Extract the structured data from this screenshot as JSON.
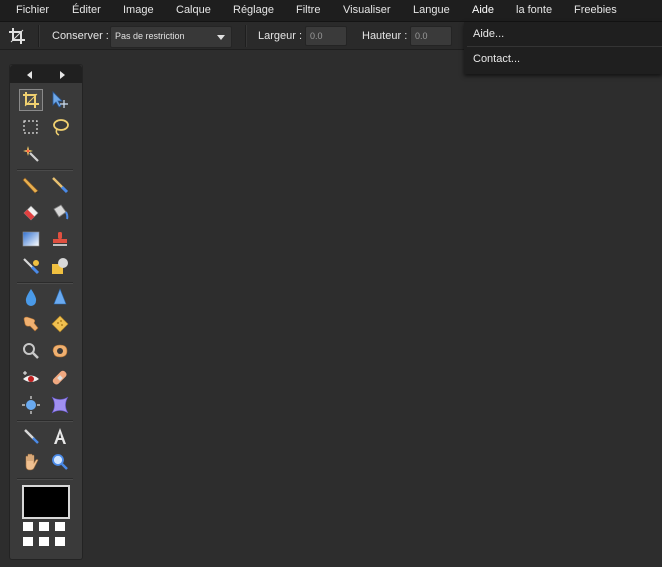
{
  "menubar": {
    "items": [
      {
        "label": "Fichier"
      },
      {
        "label": "Éditer"
      },
      {
        "label": "Image"
      },
      {
        "label": "Calque"
      },
      {
        "label": "Réglage"
      },
      {
        "label": "Filtre"
      },
      {
        "label": "Visualiser"
      },
      {
        "label": "Langue"
      },
      {
        "label": "Aide"
      },
      {
        "label": "la fonte"
      },
      {
        "label": "Freebies"
      }
    ]
  },
  "toolbar": {
    "conserver_label": "Conserver :",
    "conserver_value": "Pas de restriction",
    "largeur_label": "Largeur :",
    "largeur_value": "0.0",
    "hauteur_label": "Hauteur :",
    "hauteur_value": "0.0"
  },
  "help_menu": {
    "items": [
      {
        "label": "Aide..."
      },
      {
        "label": "Contact..."
      }
    ]
  },
  "tools": {
    "selected": "crop-tool",
    "icons": [
      "crop-icon",
      "move-icon",
      "marquee-icon",
      "lasso-icon",
      "magic-wand-icon",
      "pencil-icon",
      "brush-icon",
      "eraser-icon",
      "paint-bucket-icon",
      "gradient-icon",
      "clone-stamp-icon",
      "color-replace-icon",
      "shape-icon",
      "blur-icon",
      "sharpen-icon",
      "smudge-icon",
      "sponge-icon",
      "dodge-icon",
      "burn-icon",
      "red-eye-icon",
      "spot-heal-icon",
      "bloat-icon",
      "pinch-icon",
      "color-picker-icon",
      "type-icon",
      "hand-icon",
      "zoom-icon"
    ]
  },
  "colors": {
    "background": "#2d2d2d",
    "menubar": "#1e1e1e",
    "panel": "#3a3a3a",
    "foreground_swatch": "#000000"
  }
}
